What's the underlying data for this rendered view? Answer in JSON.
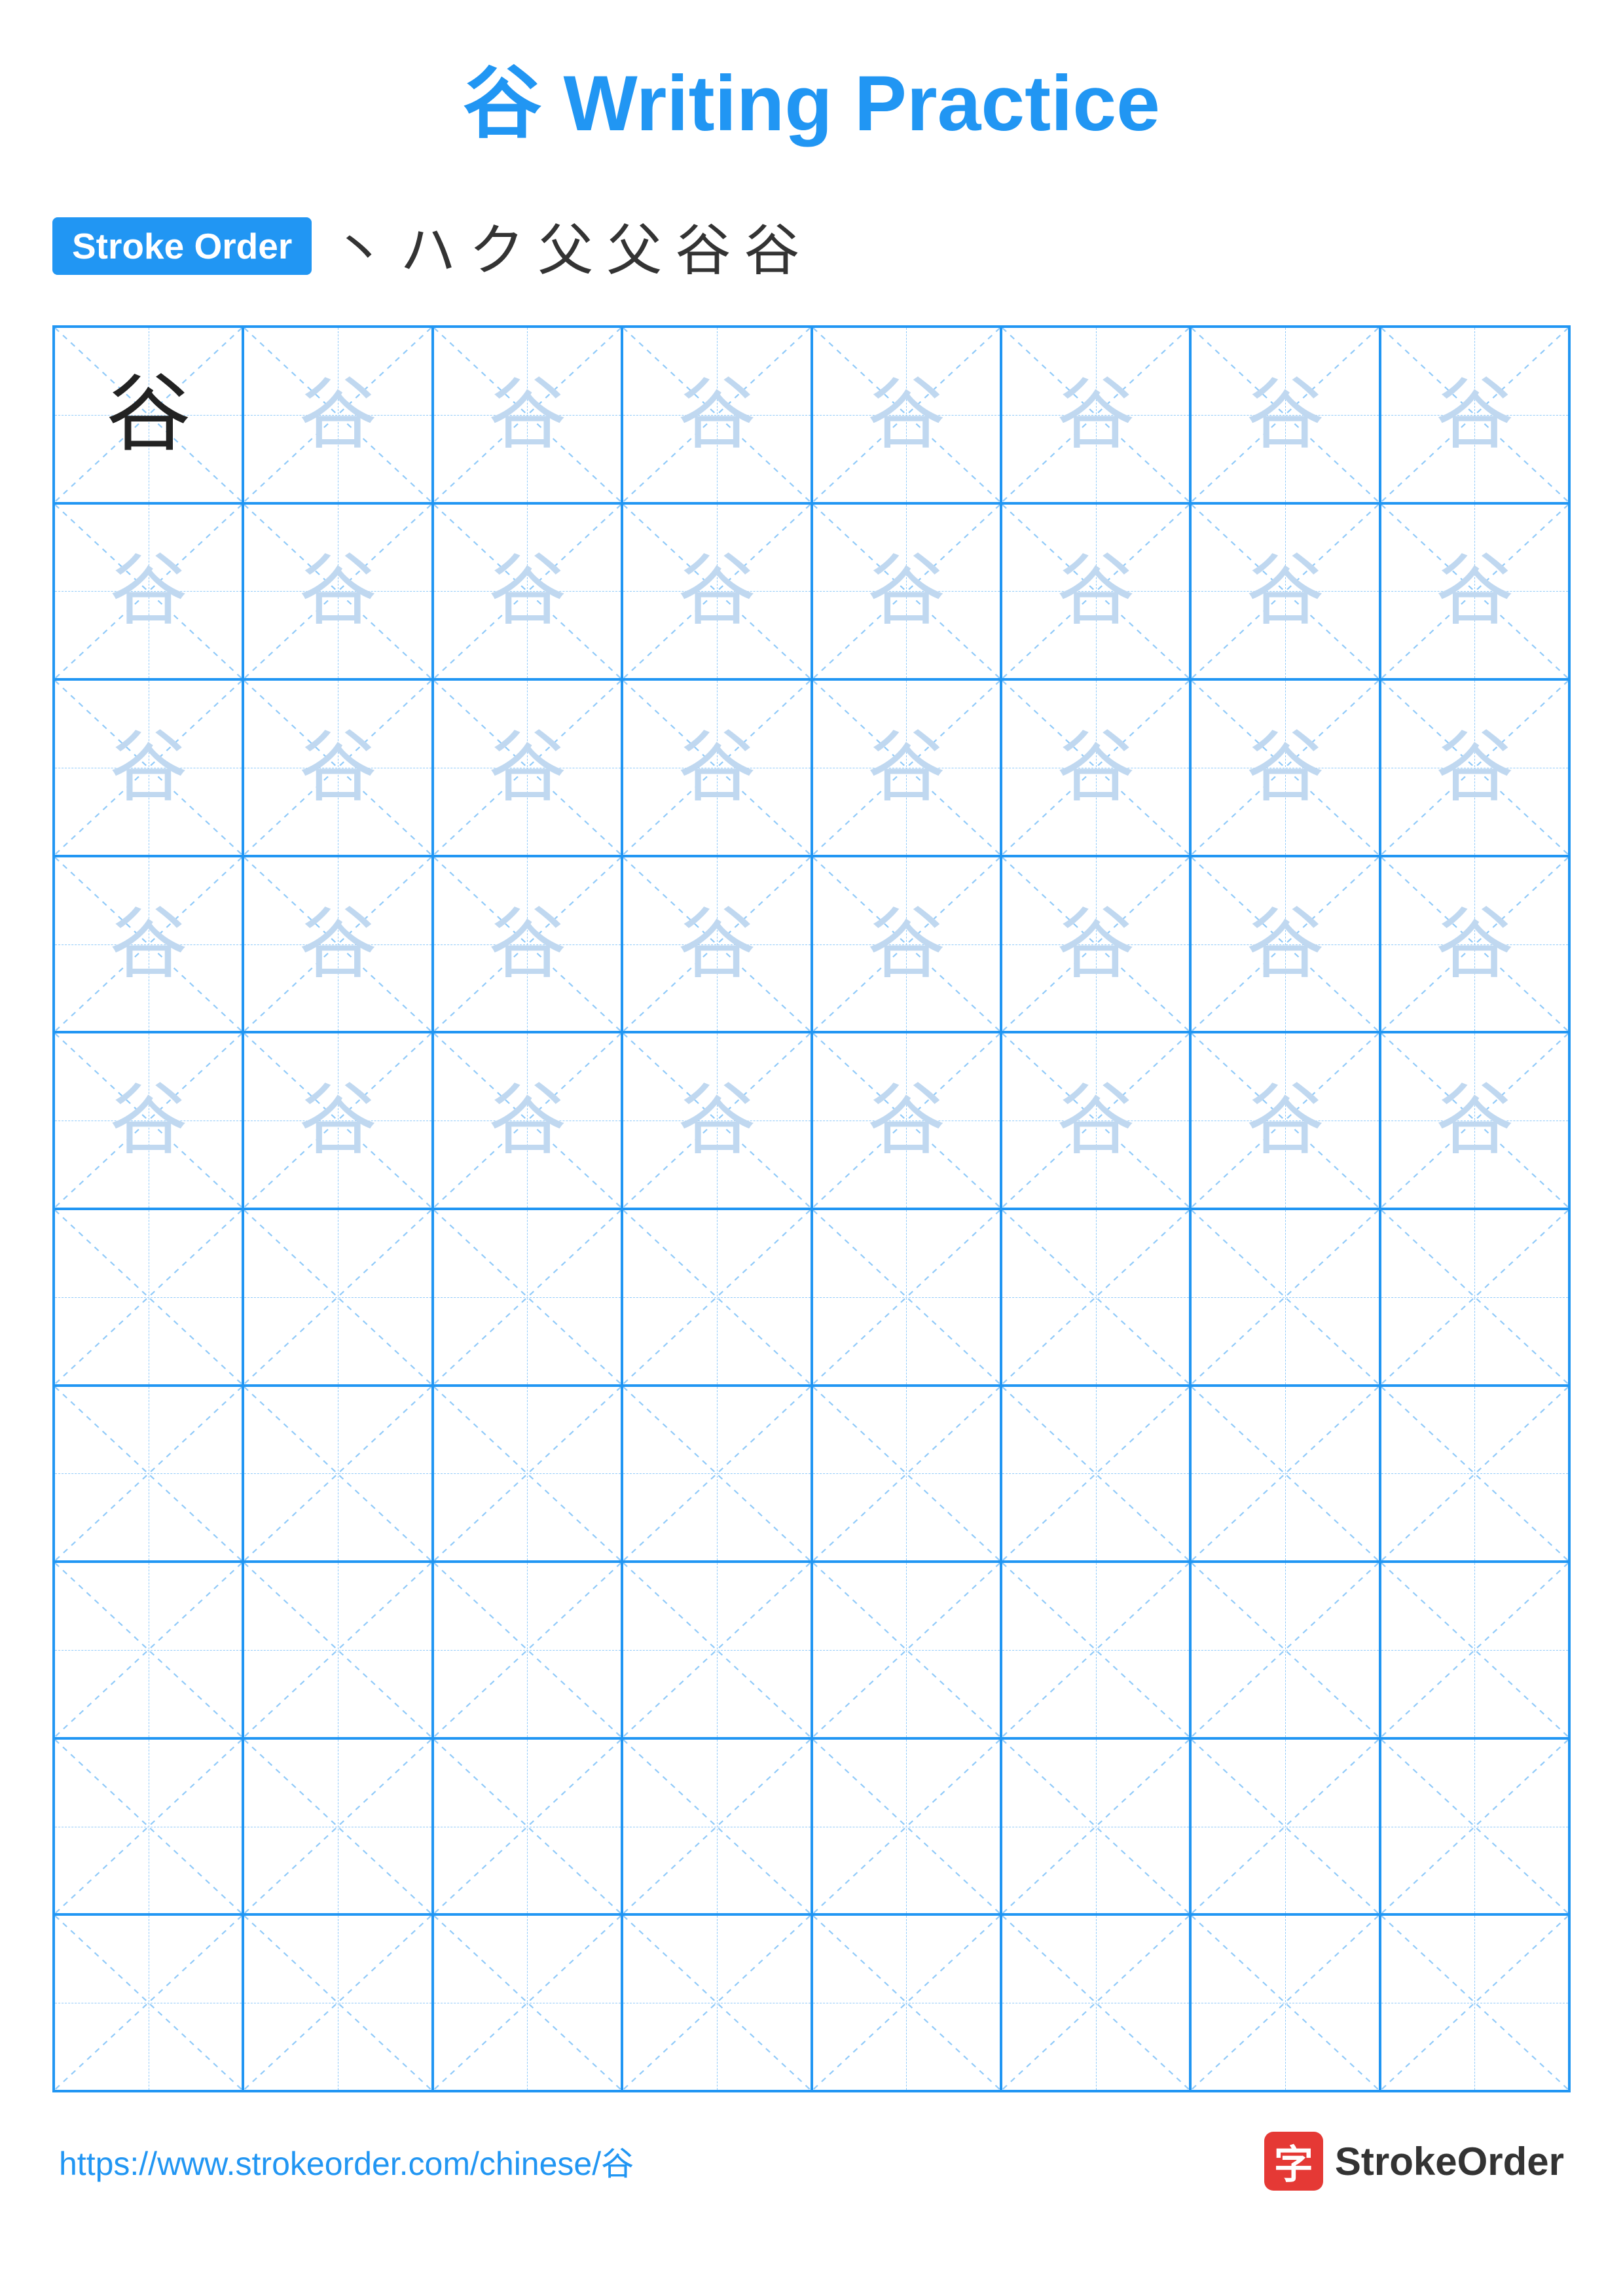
{
  "title": {
    "char": "谷",
    "text": " Writing Practice"
  },
  "stroke_order": {
    "badge_label": "Stroke Order",
    "strokes": [
      "丶",
      "ハ",
      "ク",
      "父",
      "父",
      "谷",
      "谷"
    ]
  },
  "character": "谷",
  "grid": {
    "rows": 10,
    "cols": 8,
    "ghost_rows": 5,
    "solid_row": 0
  },
  "footer": {
    "url": "https://www.strokeorder.com/chinese/谷",
    "brand_char": "字",
    "brand_name": "StrokeOrder"
  }
}
